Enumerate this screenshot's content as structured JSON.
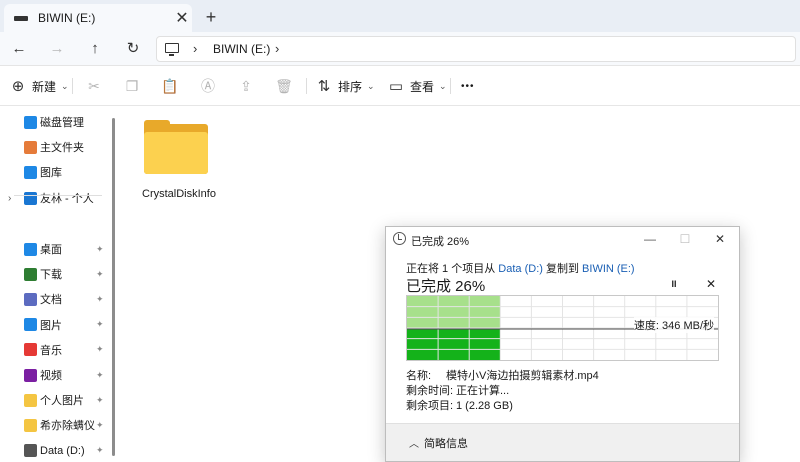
{
  "tab": {
    "title": "BIWIN (E:)",
    "close": "✕",
    "new_tab": "+"
  },
  "nav": {
    "back": "←",
    "forward": "→",
    "up": "↑",
    "refresh": "↻",
    "sep": "›",
    "location": "BIWIN (E:)"
  },
  "toolbar": {
    "new_label": "新建",
    "sort_label": "排序",
    "view_label": "查看",
    "more": "•••"
  },
  "sidebar": {
    "top_items": [
      {
        "label": "磁盘管理",
        "icon": "disk-management-icon",
        "color": "#1e88e5"
      },
      {
        "label": "主文件夹",
        "icon": "home-icon",
        "color": "#e57b3a"
      },
      {
        "label": "图库",
        "icon": "gallery-icon",
        "color": "#1e88e5"
      },
      {
        "label": "友林 - 个人",
        "icon": "onedrive-icon",
        "color": "#1976d2"
      }
    ],
    "pinned_items": [
      {
        "label": "桌面",
        "icon": "desktop-icon",
        "color": "#1e88e5"
      },
      {
        "label": "下载",
        "icon": "download-icon",
        "color": "#2e7d32"
      },
      {
        "label": "文档",
        "icon": "documents-icon",
        "color": "#5c6bc0"
      },
      {
        "label": "图片",
        "icon": "pictures-icon",
        "color": "#1e88e5"
      },
      {
        "label": "音乐",
        "icon": "music-icon",
        "color": "#e53935"
      },
      {
        "label": "视频",
        "icon": "videos-icon",
        "color": "#7b1fa2"
      },
      {
        "label": "个人图片",
        "icon": "folder-icon",
        "color": "#f4c542"
      },
      {
        "label": "希亦除螨仪",
        "icon": "folder-icon",
        "color": "#f4c542"
      },
      {
        "label": "Data (D:)",
        "icon": "drive-icon",
        "color": "#555555"
      }
    ],
    "pin_glyph": "📌",
    "expand_glyph": "›"
  },
  "content": {
    "folders": [
      {
        "name": "CrystalDiskInfo"
      }
    ]
  },
  "dialog": {
    "title": "已完成 26%",
    "minimize": "—",
    "maximize": "☐",
    "close": "✕",
    "line1_prefix": "正在将 1 个项目从",
    "source": "Data (D:)",
    "line1_mid": "复制到",
    "dest": "BIWIN (E:)",
    "percent_text": "已完成 26%",
    "pause": "II",
    "cancel": "✕",
    "progress": 0.26,
    "speed_text": "速度: 346 MB/秒",
    "name_label": "名称:",
    "name_value": "模特小V海边拍摄剪辑素材.mp4",
    "remaining_time_label": "剩余时间:",
    "remaining_time_value": "正在计算...",
    "remaining_items_label": "剩余项目:",
    "remaining_items_value": "1 (2.28 GB)",
    "less_details": "简略信息",
    "collapse_glyph": "︿",
    "colors": {
      "graph_light": "#a7e08b",
      "graph_dark": "#14b21a",
      "graph_line": "#4a4a4a",
      "link": "#1a5fb4"
    }
  }
}
